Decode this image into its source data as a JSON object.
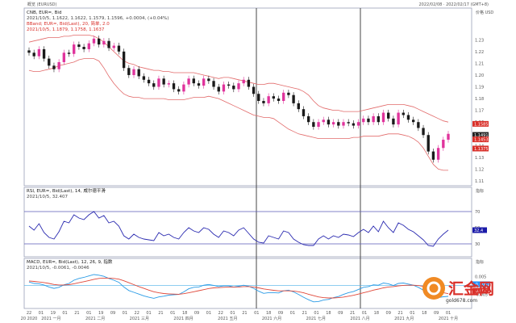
{
  "header": {
    "left": "概览 (EURUSD)",
    "right": "2022/02/08 · 2022/02/17 (GMT+8)"
  },
  "price_panel": {
    "title": "CNB, EUR=, Bid",
    "line1": "2021/10/5, 1.1622, 1.1622, 1.1579, 1.1596, +0.0004, (+0.04%)",
    "line2": "BBand; EUR=, Bid(Last), 20, 简单, 2.0",
    "line3": "2021/10/5, 1.1879, 1.1758, 1.1637",
    "unit": "价格\nUSD",
    "right_ticks": [
      "1.23",
      "1.22",
      "1.21",
      "1.20",
      "1.19",
      "1.18",
      "1.17",
      "1.16",
      "1.15",
      "1.14",
      "1.13",
      "1.12",
      "1.11"
    ],
    "tags": [
      {
        "text": "1.1585",
        "color": "#d9302a",
        "value": 1.1585
      },
      {
        "text": "1.1491",
        "color": "#222222",
        "value": 1.1491
      },
      {
        "text": "1.1453",
        "color": "#d9302a",
        "value": 1.1453
      },
      {
        "text": "1.1375",
        "color": "#d9302a",
        "value": 1.1375
      }
    ]
  },
  "rsi_panel": {
    "title": "RSI, EUR=, Bid(Last), 14, 威尔德平滑",
    "line1": "2021/10/5, 32.407",
    "unit": "指标",
    "ticks": [
      "70",
      "50",
      "30"
    ],
    "tag": {
      "text": "32.4",
      "color": "#1a1aa8"
    }
  },
  "macd_panel": {
    "title": "MACD, EUR=, Bid(Last), 12, 26, 9, 指数",
    "line1": "2021/10/5, -0.0061, -0.0046",
    "unit": "指标",
    "ticks": [
      "0.005",
      "0.000",
      "-0.005"
    ],
    "tags": [
      {
        "text": "-0.0061",
        "color": "#1e90ff"
      },
      {
        "text": "-0.0046",
        "color": "#d9302a"
      }
    ]
  },
  "x_axis": {
    "labels_top": [
      "22",
      "01",
      "19",
      "01",
      "21",
      "01",
      "19",
      "09",
      "01",
      "22",
      "01",
      "21",
      "01",
      "18",
      "09",
      "01",
      "22",
      "01",
      "21",
      "01",
      "18",
      "09",
      "01",
      "21",
      "01",
      "18",
      "09",
      "21",
      "01",
      "18",
      "09",
      "21",
      "01",
      "18",
      "09",
      "01"
    ],
    "labels_bottom": [
      "20 2020",
      "2021 一月",
      "",
      "2021 二月",
      "",
      "2021 三月",
      "",
      "2021 四月",
      "",
      "2021 五月",
      "",
      "2021 六月",
      "",
      "2021 七月",
      "",
      "2021 八月",
      "",
      "2021 九月",
      "",
      "2021 十月"
    ]
  },
  "watermark": {
    "text": "汇金网",
    "sub": "gold678.com"
  },
  "colors": {
    "up": "#e0339c",
    "down": "#1a1a1a",
    "band": "#e26a6a",
    "rsi": "#2a2ab0",
    "macd": "#2a9be6",
    "signal": "#e0483a",
    "panel_border": "#9aa0b8"
  },
  "chart_data": [
    {
      "type": "candlestick",
      "title": "CNB, EUR=, Bid",
      "ylim": [
        1.11,
        1.235
      ],
      "bbands": {
        "period": 20,
        "stdev": 2.0
      },
      "close": [
        1.219,
        1.216,
        1.222,
        1.214,
        1.208,
        1.205,
        1.211,
        1.219,
        1.218,
        1.226,
        1.224,
        1.222,
        1.227,
        1.231,
        1.226,
        1.229,
        1.223,
        1.225,
        1.22,
        1.206,
        1.2,
        1.205,
        1.199,
        1.196,
        1.193,
        1.19,
        1.197,
        1.192,
        1.193,
        1.188,
        1.186,
        1.192,
        1.197,
        1.193,
        1.191,
        1.197,
        1.195,
        1.19,
        1.186,
        1.192,
        1.191,
        1.188,
        1.193,
        1.196,
        1.19,
        1.184,
        1.178,
        1.176,
        1.182,
        1.18,
        1.178,
        1.185,
        1.183,
        1.176,
        1.171,
        1.165,
        1.16,
        1.156,
        1.16,
        1.162,
        1.158,
        1.16,
        1.157,
        1.16,
        1.159,
        1.157,
        1.16,
        1.163,
        1.16,
        1.165,
        1.16,
        1.168,
        1.163,
        1.158,
        1.168,
        1.166,
        1.162,
        1.16,
        1.155,
        1.149,
        1.135,
        1.128,
        1.138,
        1.145,
        1.15
      ],
      "upper_band": [
        1.228,
        1.229,
        1.23,
        1.231,
        1.232,
        1.232,
        1.232,
        1.233,
        1.233,
        1.234,
        1.234,
        1.234,
        1.234,
        1.233,
        1.231,
        1.228,
        1.224,
        1.22,
        1.216,
        1.212,
        1.21,
        1.209,
        1.207,
        1.206,
        1.205,
        1.204,
        1.204,
        1.203,
        1.203,
        1.202,
        1.202,
        1.202,
        1.202,
        1.202,
        1.201,
        1.2,
        1.199,
        1.198,
        1.197,
        1.198,
        1.198,
        1.197,
        1.196,
        1.195,
        1.194,
        1.193,
        1.192,
        1.192,
        1.193,
        1.193,
        1.192,
        1.191,
        1.19,
        1.189,
        1.188,
        1.186,
        1.183,
        1.178,
        1.174,
        1.172,
        1.171,
        1.17,
        1.17,
        1.169,
        1.169,
        1.169,
        1.169,
        1.17,
        1.171,
        1.172,
        1.173,
        1.174,
        1.175,
        1.175,
        1.175,
        1.175,
        1.174,
        1.173,
        1.171,
        1.169,
        1.167,
        1.165,
        1.163,
        1.161,
        1.16
      ],
      "lower_band": [
        1.204,
        1.203,
        1.203,
        1.204,
        1.205,
        1.206,
        1.208,
        1.209,
        1.21,
        1.211,
        1.213,
        1.214,
        1.214,
        1.214,
        1.212,
        1.206,
        1.199,
        1.193,
        1.188,
        1.184,
        1.182,
        1.181,
        1.181,
        1.18,
        1.18,
        1.18,
        1.18,
        1.18,
        1.179,
        1.179,
        1.179,
        1.179,
        1.18,
        1.181,
        1.181,
        1.181,
        1.182,
        1.181,
        1.18,
        1.178,
        1.176,
        1.174,
        1.172,
        1.17,
        1.168,
        1.166,
        1.165,
        1.164,
        1.164,
        1.163,
        1.16,
        1.157,
        1.154,
        1.152,
        1.15,
        1.149,
        1.148,
        1.147,
        1.146,
        1.146,
        1.146,
        1.146,
        1.146,
        1.146,
        1.146,
        1.147,
        1.147,
        1.148,
        1.148,
        1.148,
        1.148,
        1.149,
        1.15,
        1.15,
        1.15,
        1.149,
        1.148,
        1.146,
        1.143,
        1.138,
        1.131,
        1.124,
        1.12,
        1.119,
        1.119
      ]
    },
    {
      "type": "line",
      "title": "RSI, EUR=, Bid(Last), 14",
      "ylim": [
        20,
        80
      ],
      "hlines": [
        70,
        30
      ],
      "series": [
        {
          "name": "RSI",
          "values": [
            52,
            47,
            55,
            44,
            38,
            36,
            45,
            58,
            56,
            66,
            62,
            60,
            66,
            70,
            62,
            65,
            56,
            58,
            52,
            40,
            36,
            42,
            38,
            36,
            35,
            34,
            44,
            40,
            42,
            38,
            36,
            44,
            50,
            46,
            44,
            50,
            48,
            42,
            38,
            46,
            44,
            40,
            47,
            50,
            43,
            36,
            32,
            31,
            40,
            38,
            36,
            46,
            44,
            36,
            32,
            29,
            28,
            28,
            36,
            40,
            36,
            40,
            38,
            42,
            41,
            39,
            44,
            48,
            44,
            52,
            45,
            58,
            50,
            44,
            56,
            53,
            48,
            45,
            40,
            35,
            28,
            27,
            36,
            42,
            47
          ]
        }
      ]
    },
    {
      "type": "line",
      "title": "MACD, EUR=, Bid(Last), 12, 26, 9",
      "ylim": [
        -0.012,
        0.008
      ],
      "hlines": [
        0
      ],
      "series": [
        {
          "name": "MACD",
          "values": [
            0.002,
            0.0012,
            0.001,
            0.0003,
            -0.0008,
            -0.0016,
            -0.001,
            0.0004,
            0.0012,
            0.003,
            0.004,
            0.0046,
            0.0054,
            0.0062,
            0.0058,
            0.0052,
            0.004,
            0.003,
            0.0018,
            -0.0008,
            -0.0028,
            -0.0038,
            -0.0048,
            -0.0058,
            -0.0066,
            -0.0072,
            -0.0064,
            -0.006,
            -0.0054,
            -0.0052,
            -0.005,
            -0.0036,
            -0.0018,
            -0.001,
            -0.0008,
            0.0002,
            0.0006,
            0.0001,
            -0.0006,
            -0.0002,
            -0.0002,
            -0.0008,
            -0.0004,
            0.0002,
            -0.0004,
            -0.0016,
            -0.0032,
            -0.0044,
            -0.004,
            -0.004,
            -0.0042,
            -0.003,
            -0.0026,
            -0.0036,
            -0.005,
            -0.0066,
            -0.008,
            -0.0092,
            -0.009,
            -0.0082,
            -0.0078,
            -0.0068,
            -0.0062,
            -0.005,
            -0.004,
            -0.0034,
            -0.0022,
            -0.001,
            -0.0006,
            0.0004,
            0.0002,
            0.0014,
            0.001,
            0.0,
            0.0012,
            0.0014,
            0.0008,
            0.0002,
            -0.001,
            -0.0026,
            -0.0052,
            -0.007,
            -0.0068,
            -0.0063,
            -0.0061
          ]
        },
        {
          "name": "Signal",
          "values": [
            0.0026,
            0.0023,
            0.002,
            0.0017,
            0.0012,
            0.0006,
            0.0003,
            0.0003,
            0.0005,
            0.001,
            0.0016,
            0.0022,
            0.0028,
            0.0035,
            0.004,
            0.0042,
            0.0042,
            0.004,
            0.0036,
            0.0027,
            0.0016,
            0.0005,
            -0.0006,
            -0.0016,
            -0.0026,
            -0.0035,
            -0.0041,
            -0.0045,
            -0.0047,
            -0.0048,
            -0.0049,
            -0.0046,
            -0.0041,
            -0.0035,
            -0.0029,
            -0.0023,
            -0.0017,
            -0.0013,
            -0.0012,
            -0.001,
            -0.0009,
            -0.0009,
            -0.0008,
            -0.0006,
            -0.0006,
            -0.0008,
            -0.0013,
            -0.0019,
            -0.0023,
            -0.0027,
            -0.003,
            -0.003,
            -0.003,
            -0.0031,
            -0.0035,
            -0.0041,
            -0.0049,
            -0.0057,
            -0.0064,
            -0.0068,
            -0.007,
            -0.007,
            -0.0068,
            -0.0065,
            -0.006,
            -0.0055,
            -0.0048,
            -0.0041,
            -0.0034,
            -0.0026,
            -0.002,
            -0.0013,
            -0.0008,
            -0.0006,
            -0.0002,
            0.0001,
            0.0002,
            0.0002,
            0.0,
            -0.0005,
            -0.0014,
            -0.0025,
            -0.0034,
            -0.004,
            -0.0046
          ]
        }
      ]
    }
  ]
}
